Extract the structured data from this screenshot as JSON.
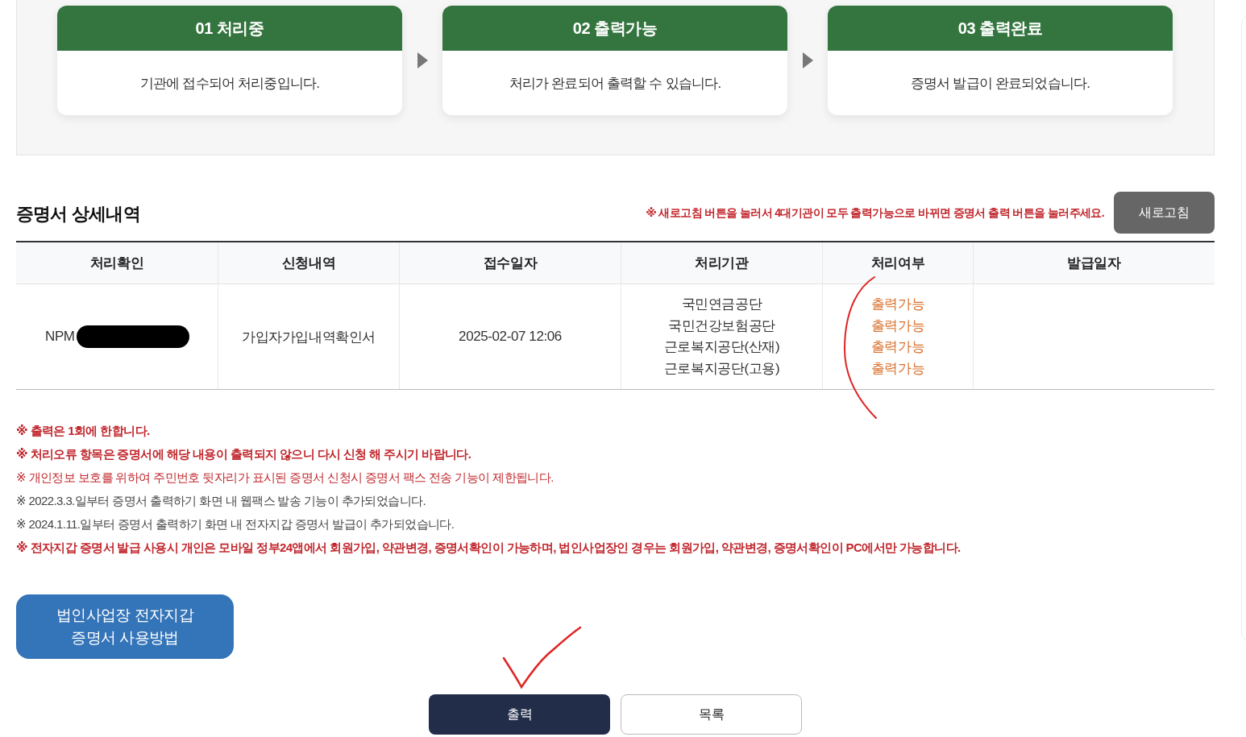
{
  "steps": [
    {
      "label": "01 처리중",
      "description": "기관에 접수되어 처리중입니다."
    },
    {
      "label": "02 출력가능",
      "description": "처리가 완료되어 출력할 수 있습니다."
    },
    {
      "label": "03 출력완료",
      "description": "증명서 발급이 완료되었습니다."
    }
  ],
  "details": {
    "title": "증명서 상세내역",
    "notice": "※ 새로고침 버튼을 눌러서 4대기관이 모두 출력가능으로 바뀌면 증명서 출력 버튼을 눌러주세요.",
    "refresh_button": "새로고침"
  },
  "table": {
    "columns": [
      "처리확인",
      "신청내역",
      "접수일자",
      "처리기관",
      "처리여부",
      "발급일자"
    ],
    "rows": [
      {
        "receipt_no": "NPM",
        "redacted": true,
        "application": "가입자가입내역확인서",
        "received": "2025-02-07 12:06",
        "agencies": [
          "국민연금공단",
          "국민건강보험공단",
          "근로복지공단(산재)",
          "근로복지공단(고용)"
        ],
        "statuses": [
          "출력가능",
          "출력가능",
          "출력가능",
          "출력가능"
        ]
      }
    ]
  },
  "notes": [
    {
      "kind": "strong",
      "text": "※ 출력은 1회에 한합니다."
    },
    {
      "kind": "strong",
      "text": "※ 처리오류 항목은 증명서에 해당 내용이 출력되지 않으니 다시 신청 해 주시기 바랍니다."
    },
    {
      "kind": "warning",
      "text": "※ 개인정보 보호를 위하여 주민번호 뒷자리가 표시된 증명서 신청시 증명서 팩스 전송 기능이 제한됩니다."
    },
    {
      "kind": "plain",
      "text": "※ 2022.3.3.일부터 증명서 출력하기 화면 내 웹팩스 발송 기능이 추가되었습니다."
    },
    {
      "kind": "plain",
      "text": "※ 2024.1.11.일부터 증명서 출력하기 화면 내 전자지갑 증명서 발급이 추가되었습니다."
    },
    {
      "kind": "strong",
      "text": "※ 전자지갑 증명서 발급 사용시 개인은 모바일 정부24앱에서 회원가입, 약관변경, 증명서확인이 가능하며, 법인사업장인 경우는 회원가입, 약관변경, 증명서확인이 PC에서만 가능합니다."
    }
  ],
  "guide_button": [
    "법인사업장 전자지갑",
    "증명서 사용방법"
  ],
  "actions": [
    {
      "kind": "primary",
      "label": "출력"
    },
    {
      "kind": "secondary",
      "label": "목록"
    }
  ]
}
